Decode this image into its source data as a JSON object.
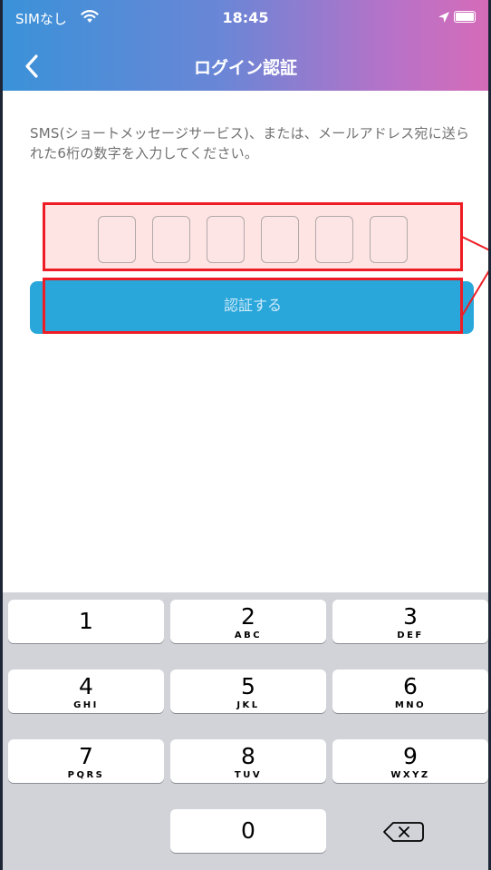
{
  "status_bar": {
    "carrier": "SIMなし",
    "time": "18:45"
  },
  "nav": {
    "title": "ログイン認証"
  },
  "instructions": "SMS(ショートメッセージサービス)、または、メールアドレス宛に送られた6桁の数字を入力してください。",
  "code_digits": [
    "",
    "",
    "",
    "",
    "",
    ""
  ],
  "verify_button": "認証する",
  "keypad": {
    "keys": [
      {
        "num": "1",
        "letters": ""
      },
      {
        "num": "2",
        "letters": "ABC"
      },
      {
        "num": "3",
        "letters": "DEF"
      },
      {
        "num": "4",
        "letters": "GHI"
      },
      {
        "num": "5",
        "letters": "JKL"
      },
      {
        "num": "6",
        "letters": "MNO"
      },
      {
        "num": "7",
        "letters": "PQRS"
      },
      {
        "num": "8",
        "letters": "TUV"
      },
      {
        "num": "9",
        "letters": "WXYZ"
      },
      {
        "num": "0",
        "letters": ""
      }
    ],
    "delete_icon": "backspace-icon"
  },
  "colors": {
    "header_gradient": [
      "#3a92d8",
      "#d56bb8"
    ],
    "button": "#2aa7da",
    "highlight_border": "#ee1d25",
    "highlight_fill": "#ffe4e4",
    "keyboard_bg": "#d1d3d9"
  }
}
